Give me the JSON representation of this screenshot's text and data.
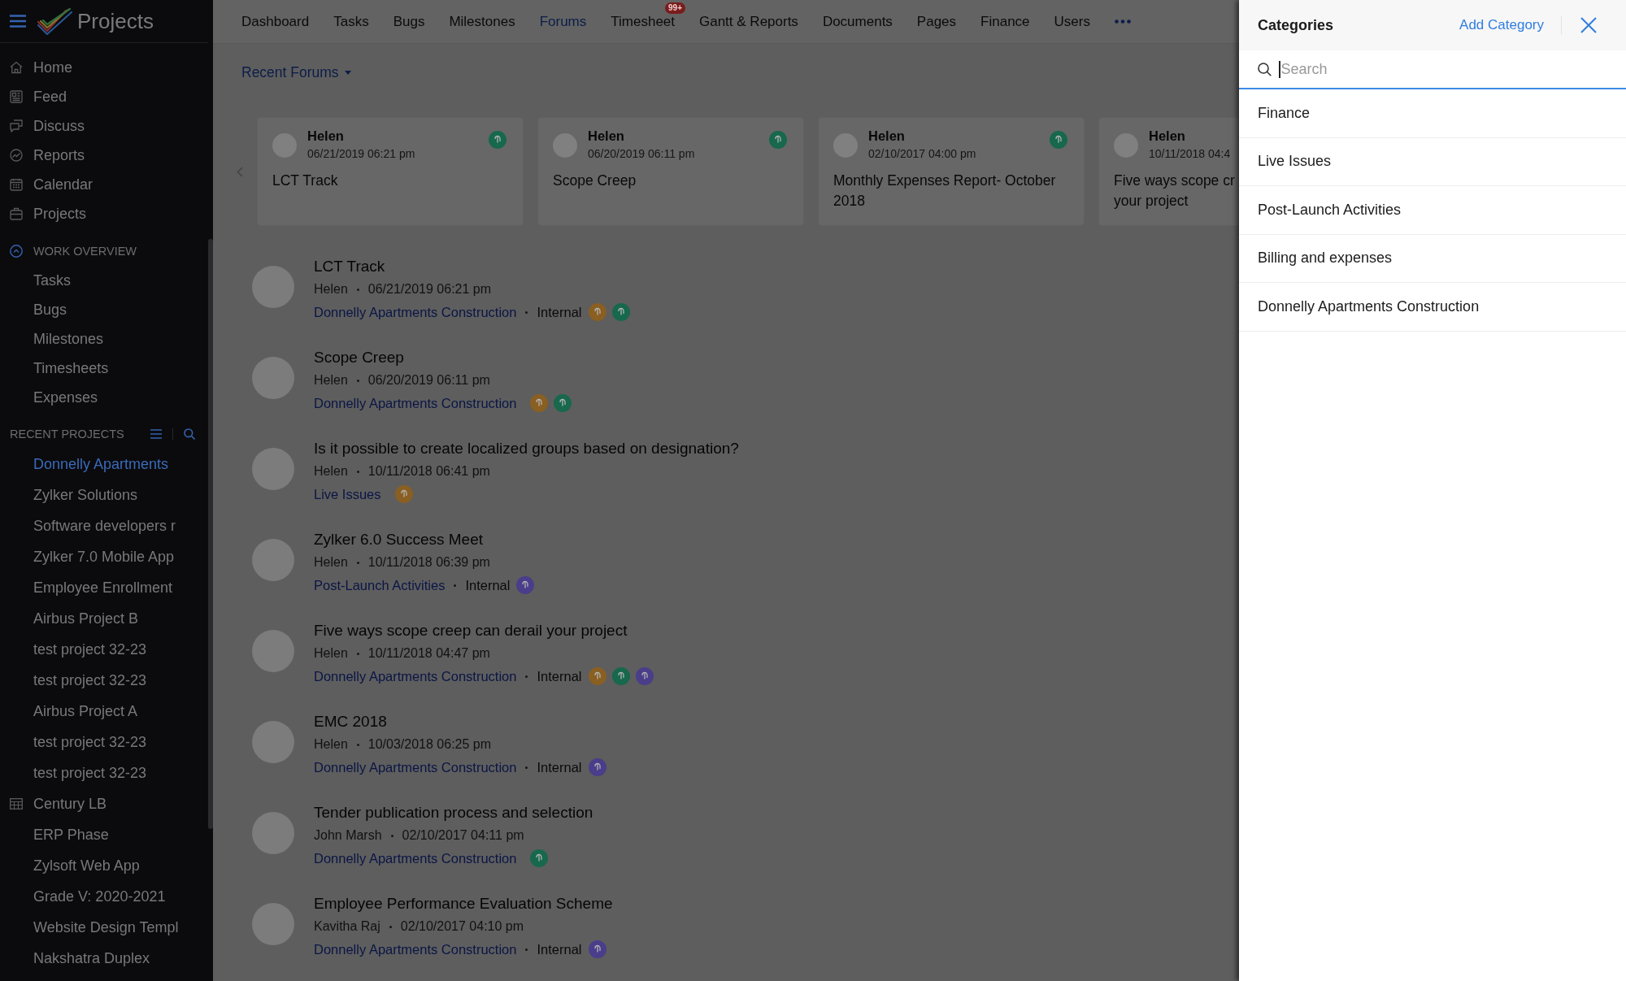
{
  "sidebar": {
    "app_title": "Projects",
    "nav": [
      {
        "label": "Home"
      },
      {
        "label": "Feed"
      },
      {
        "label": "Discuss"
      },
      {
        "label": "Reports"
      },
      {
        "label": "Calendar"
      },
      {
        "label": "Projects"
      }
    ],
    "work_overview": {
      "label": "WORK OVERVIEW",
      "expanded": true,
      "items": [
        {
          "label": "Tasks"
        },
        {
          "label": "Bugs"
        },
        {
          "label": "Milestones"
        },
        {
          "label": "Timesheets"
        },
        {
          "label": "Expenses"
        }
      ]
    },
    "recent_projects": {
      "label": "RECENT PROJECTS",
      "items": [
        {
          "label": "Donnelly Apartments",
          "selected": true,
          "kind": "plain"
        },
        {
          "label": "Zylker Solutions",
          "selected": false,
          "kind": "plain"
        },
        {
          "label": "Software developers r",
          "selected": false,
          "kind": "plain"
        },
        {
          "label": "Zylker 7.0 Mobile App",
          "selected": false,
          "kind": "plain"
        },
        {
          "label": "Employee Enrollment",
          "selected": false,
          "kind": "plain"
        },
        {
          "label": "Airbus Project B",
          "selected": false,
          "kind": "plain"
        },
        {
          "label": "test project 32-23",
          "selected": false,
          "kind": "plain"
        },
        {
          "label": "test project 32-23",
          "selected": false,
          "kind": "plain"
        },
        {
          "label": "Airbus Project A",
          "selected": false,
          "kind": "plain"
        },
        {
          "label": "test project 32-23",
          "selected": false,
          "kind": "plain"
        },
        {
          "label": "test project 32-23",
          "selected": false,
          "kind": "plain"
        },
        {
          "label": "Century LB",
          "selected": false,
          "kind": "with-icon"
        },
        {
          "label": "ERP Phase",
          "selected": false,
          "kind": "plain"
        },
        {
          "label": "Zylsoft Web App",
          "selected": false,
          "kind": "plain"
        },
        {
          "label": "Grade V: 2020-2021",
          "selected": false,
          "kind": "plain"
        },
        {
          "label": "Website Design Templ",
          "selected": false,
          "kind": "plain"
        },
        {
          "label": "Nakshatra Duplex",
          "selected": false,
          "kind": "plain"
        }
      ]
    }
  },
  "top_nav": {
    "tabs": [
      {
        "label": "Dashboard",
        "selected": false
      },
      {
        "label": "Tasks",
        "selected": false
      },
      {
        "label": "Bugs",
        "selected": false
      },
      {
        "label": "Milestones",
        "selected": false
      },
      {
        "label": "Forums",
        "selected": true
      },
      {
        "label": "Timesheet",
        "selected": false,
        "badge": "99+"
      },
      {
        "label": "Gantt & Reports",
        "selected": false
      },
      {
        "label": "Documents",
        "selected": false
      },
      {
        "label": "Pages",
        "selected": false
      },
      {
        "label": "Finance",
        "selected": false
      },
      {
        "label": "Users",
        "selected": false
      }
    ]
  },
  "forum_filter": {
    "label": "Recent Forums"
  },
  "forum_cards": [
    {
      "author": "Helen",
      "date": "06/21/2019 06:21 pm",
      "title": "LCT Track",
      "tags": [
        {
          "color": "#17684c"
        }
      ]
    },
    {
      "author": "Helen",
      "date": "06/20/2019 06:11 pm",
      "title": "Scope Creep",
      "tags": [
        {
          "color": "#17684c"
        }
      ]
    },
    {
      "author": "Helen",
      "date": "02/10/2017 04:00 pm",
      "title": "Monthly Expenses Report- October\n2018",
      "tags": [
        {
          "color": "#17684c"
        }
      ]
    },
    {
      "author": "Helen",
      "date": "10/11/2018 04:4",
      "title": "Five ways scope cr\nyour project"
    }
  ],
  "forums": [
    {
      "title": "LCT Track",
      "author": "Helen",
      "date": "06/21/2019 06:21 pm",
      "category": "Donnelly Apartments Construction",
      "visibility": "Internal",
      "tags": [
        {
          "color": "#8a5f22"
        },
        {
          "color": "#17684c"
        }
      ]
    },
    {
      "title": "Scope Creep",
      "author": "Helen",
      "date": "06/20/2019 06:11 pm",
      "category": "Donnelly Apartments Construction",
      "tags": [
        {
          "color": "#8a5f22"
        },
        {
          "color": "#17684c"
        }
      ]
    },
    {
      "title": "Is it possible to create localized groups based on designation?",
      "author": "Helen",
      "date": "10/11/2018 06:41 pm",
      "category": "Live Issues",
      "tags": [
        {
          "color": "#8a5f22"
        }
      ]
    },
    {
      "title": "Zylker 6.0 Success Meet",
      "author": "Helen",
      "date": "10/11/2018 06:39 pm",
      "category": "Post-Launch Activities",
      "visibility": "Internal",
      "tags": [
        {
          "color": "#4a3d8a"
        }
      ]
    },
    {
      "title": "Five ways scope creep can derail your project",
      "author": "Helen",
      "date": "10/11/2018 04:47 pm",
      "category": "Donnelly Apartments Construction",
      "visibility": "Internal",
      "tags": [
        {
          "color": "#8a5f22"
        },
        {
          "color": "#17684c"
        },
        {
          "color": "#4a3d8a"
        }
      ]
    },
    {
      "title": "EMC 2018",
      "author": "Helen",
      "date": "10/03/2018 06:25 pm",
      "category": "Donnelly Apartments Construction",
      "visibility": "Internal",
      "tags": [
        {
          "color": "#4a3d8a"
        }
      ]
    },
    {
      "title": "Tender publication process and selection",
      "author": "John Marsh",
      "date": "02/10/2017 04:11 pm",
      "category": "Donnelly Apartments Construction",
      "tags": [
        {
          "color": "#17684c"
        }
      ]
    },
    {
      "title": "Employee Performance Evaluation Scheme",
      "author": "Kavitha Raj",
      "date": "02/10/2017 04:10 pm",
      "category": "Donnelly Apartments Construction",
      "visibility": "Internal",
      "tags": [
        {
          "color": "#4a3d8a"
        }
      ]
    }
  ],
  "categories_panel": {
    "title": "Categories",
    "add_label": "Add Category",
    "search": {
      "placeholder": "Search",
      "focused": true
    },
    "items": [
      {
        "label": "Finance"
      },
      {
        "label": "Live Issues"
      },
      {
        "label": "Post-Launch Activities"
      },
      {
        "label": "Billing and expenses"
      },
      {
        "label": "Donnelly Apartments Construction"
      }
    ]
  }
}
